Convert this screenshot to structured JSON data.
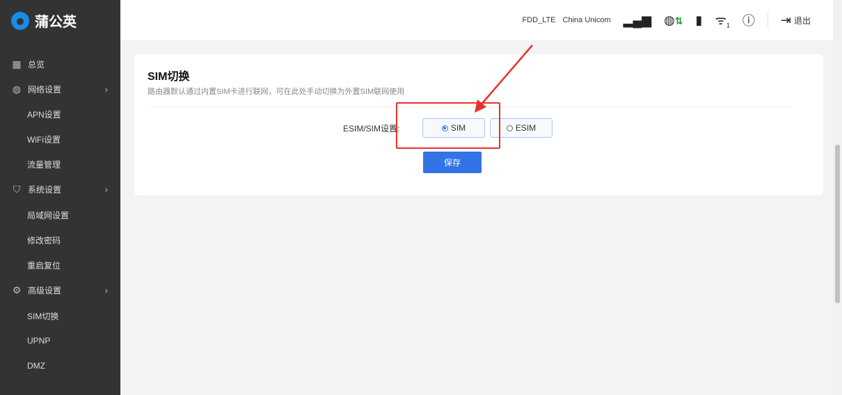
{
  "brand": {
    "name": "蒲公英",
    "accent": "#1a8be6"
  },
  "sidebar": {
    "items": [
      {
        "label": "总览",
        "icon": "grid-icon"
      },
      {
        "label": "网络设置",
        "icon": "globe-icon",
        "expandable": true
      },
      {
        "label": "APN设置"
      },
      {
        "label": "WiFi设置"
      },
      {
        "label": "流量管理"
      },
      {
        "label": "系统设置",
        "icon": "shield-icon",
        "expandable": true
      },
      {
        "label": "局域网设置"
      },
      {
        "label": "修改密码"
      },
      {
        "label": "重启复位"
      },
      {
        "label": "高级设置",
        "icon": "gear-icon",
        "expandable": true
      },
      {
        "label": "SIM切换"
      },
      {
        "label": "UPNP"
      },
      {
        "label": "DMZ"
      }
    ]
  },
  "topbar": {
    "network_mode": "FDD_LTE",
    "carrier": "China Unicom",
    "wifi_clients": "1",
    "logout": "退出"
  },
  "card": {
    "title": "SIM切换",
    "description": "路由器默认通过内置SIM卡进行联网，可在此处手动切换为外置SIM联网使用",
    "field_label": "ESIM/SIM设置:",
    "options": [
      {
        "label": "SIM",
        "selected": true
      },
      {
        "label": "ESIM",
        "selected": false
      }
    ],
    "save": "保存"
  }
}
